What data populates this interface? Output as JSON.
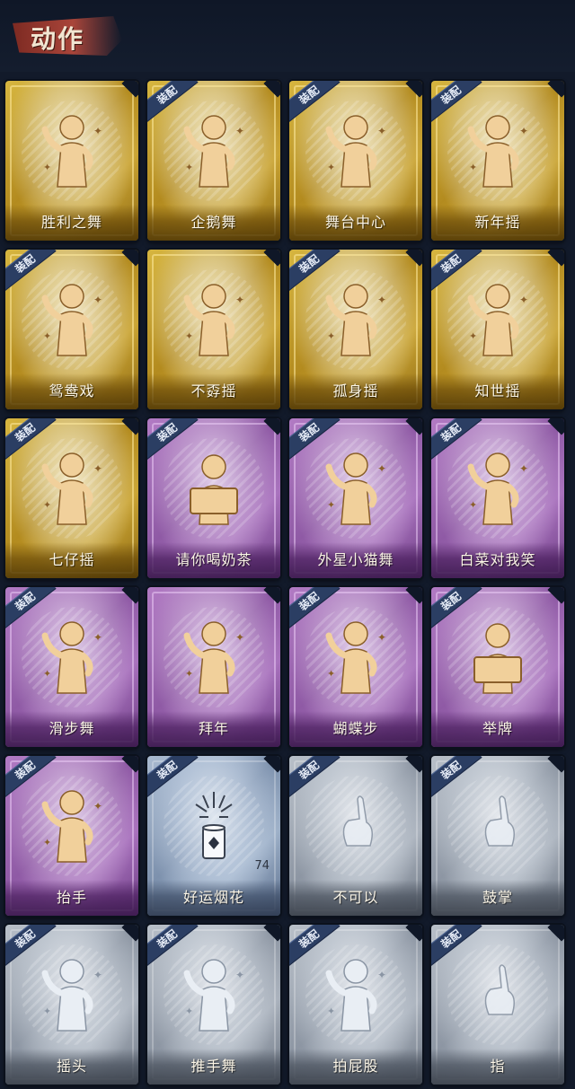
{
  "header": {
    "title": "动作"
  },
  "equip_label": "装配",
  "cards": [
    {
      "name": "胜利之舞",
      "tier": "gold",
      "equipped": false,
      "icon": "victory-dance-pose-icon"
    },
    {
      "name": "企鹅舞",
      "tier": "gold",
      "equipped": true,
      "icon": "penguin-dance-pose-icon"
    },
    {
      "name": "舞台中心",
      "tier": "gold",
      "equipped": true,
      "icon": "center-stage-pose-icon"
    },
    {
      "name": "新年摇",
      "tier": "gold",
      "equipped": true,
      "icon": "new-year-shake-pose-icon"
    },
    {
      "name": "鸳鸯戏",
      "tier": "gold",
      "equipped": true,
      "icon": "mandarin-duck-pose-icon"
    },
    {
      "name": "不孬摇",
      "tier": "gold",
      "equipped": false,
      "icon": "arm-raise-shake-pose-icon"
    },
    {
      "name": "孤身摇",
      "tier": "gold",
      "equipped": true,
      "icon": "solo-shake-pose-icon"
    },
    {
      "name": "知世摇",
      "tier": "gold",
      "equipped": true,
      "icon": "zhishi-shake-pose-icon"
    },
    {
      "name": "七仔摇",
      "tier": "gold",
      "equipped": true,
      "icon": "qizai-shake-pose-icon"
    },
    {
      "name": "请你喝奶茶",
      "tier": "purple",
      "equipped": true,
      "icon": "milk-tea-sign-pose-icon"
    },
    {
      "name": "外星小猫舞",
      "tier": "purple",
      "equipped": true,
      "icon": "alien-cat-dance-pose-icon"
    },
    {
      "name": "白菜对我笑",
      "tier": "purple",
      "equipped": true,
      "icon": "cabbage-smile-pose-icon"
    },
    {
      "name": "滑步舞",
      "tier": "purple",
      "equipped": true,
      "icon": "slide-step-pose-icon"
    },
    {
      "name": "拜年",
      "tier": "purple",
      "equipped": false,
      "icon": "new-year-greeting-pose-icon"
    },
    {
      "name": "蝴蝶步",
      "tier": "purple",
      "equipped": true,
      "icon": "butterfly-step-pose-icon"
    },
    {
      "name": "举牌",
      "tier": "purple",
      "equipped": true,
      "icon": "hold-sign-pose-icon"
    },
    {
      "name": "抬手",
      "tier": "purple",
      "equipped": true,
      "icon": "raise-hand-pose-icon"
    },
    {
      "name": "好运烟花",
      "tier": "blue",
      "equipped": true,
      "icon": "firework-item-icon",
      "count": "74"
    },
    {
      "name": "不可以",
      "tier": "silver",
      "equipped": true,
      "icon": "wagging-finger-icon"
    },
    {
      "name": "鼓掌",
      "tier": "silver",
      "equipped": true,
      "icon": "clapping-hands-icon"
    },
    {
      "name": "摇头",
      "tier": "silver",
      "equipped": true,
      "icon": "head-shake-pose-icon"
    },
    {
      "name": "推手舞",
      "tier": "silver",
      "equipped": true,
      "icon": "push-hand-dance-pose-icon"
    },
    {
      "name": "拍屁股",
      "tier": "silver",
      "equipped": true,
      "icon": "butt-slap-pose-icon"
    },
    {
      "name": "指",
      "tier": "silver",
      "equipped": true,
      "icon": "pointing-hand-icon"
    }
  ]
}
